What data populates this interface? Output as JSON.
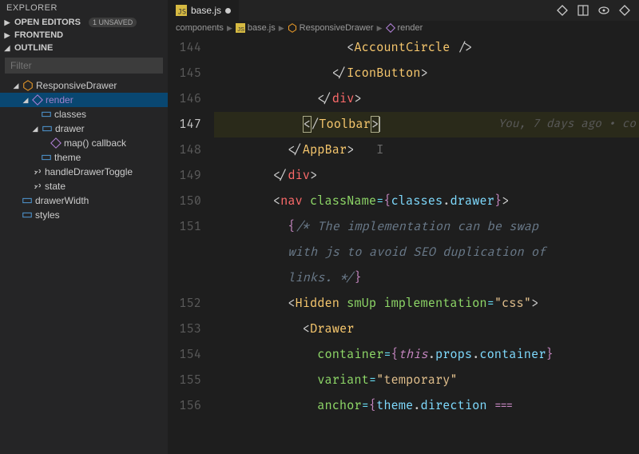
{
  "sidebar": {
    "title": "EXPLORER",
    "open_editors": {
      "label": "OPEN EDITORS",
      "badge": "1 UNSAVED"
    },
    "frontend": {
      "label": "FRONTEND"
    },
    "outline": {
      "label": "OUTLINE",
      "filter_placeholder": "Filter",
      "items": {
        "responsiveDrawer": "ResponsiveDrawer",
        "render": "render",
        "classes": "classes",
        "drawer": "drawer",
        "mapcb": "map() callback",
        "theme": "theme",
        "handleDrawerToggle": "handleDrawerToggle",
        "state": "state",
        "drawerWidth": "drawerWidth",
        "styles": "styles"
      }
    }
  },
  "tab": {
    "filename": "base.js"
  },
  "breadcrumbs": {
    "components": "components",
    "file": "base.js",
    "class": "ResponsiveDrawer",
    "method": "render"
  },
  "gutter": [
    "144",
    "145",
    "146",
    "147",
    "148",
    "149",
    "150",
    "151",
    "",
    "",
    "152",
    "153",
    "154",
    "155",
    "156"
  ],
  "blame": "You, 7 days ago • co",
  "code": {
    "l144": {
      "comp": "AccountCircle"
    },
    "l145": {
      "comp": "IconButton"
    },
    "l146": {
      "tag": "div"
    },
    "l147": {
      "comp": "Toolbar"
    },
    "l148": {
      "comp": "AppBar"
    },
    "l149": {
      "tag": "div"
    },
    "l150": {
      "tag": "nav",
      "attr": "className",
      "var1": "classes",
      "var2": "drawer"
    },
    "l151": {
      "comment": "/* The implementation can be swap"
    },
    "l151b": {
      "comment": "with js to avoid SEO duplication of"
    },
    "l151c": {
      "comment": "links. */"
    },
    "l152": {
      "comp": "Hidden",
      "attr1": "smUp",
      "attr2": "implementation",
      "str": "\"css\""
    },
    "l153": {
      "comp": "Drawer"
    },
    "l154": {
      "attr": "container",
      "kw": "this",
      "var1": "props",
      "var2": "container"
    },
    "l155": {
      "attr": "variant",
      "str": "\"temporary\""
    },
    "l156": {
      "attr": "anchor",
      "var1": "theme",
      "var2": "direction"
    }
  }
}
